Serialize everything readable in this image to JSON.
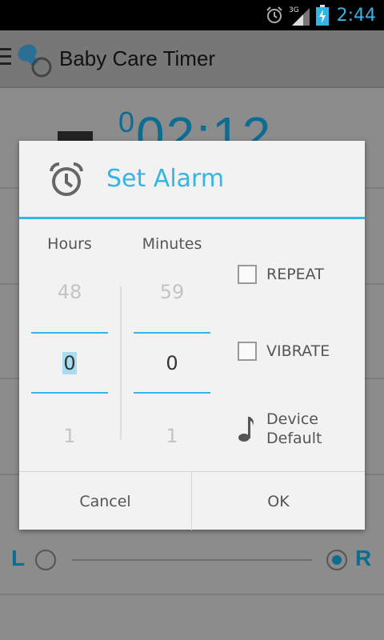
{
  "status_bar": {
    "time": "2:44",
    "network": "3G",
    "icons": [
      "alarm-icon",
      "signal-icon",
      "battery-charging-icon"
    ],
    "accent": "#33b5e5"
  },
  "app": {
    "title": "Baby Care Timer",
    "icons": [
      "menu-icon",
      "pacifier-icon"
    ]
  },
  "background": {
    "timer_superscript": "0",
    "timer_text": "02:12",
    "left_label": "L",
    "right_label": "R",
    "selected_side": "R"
  },
  "dialog": {
    "title": "Set Alarm",
    "title_color": "#33b5e5",
    "hours": {
      "label": "Hours",
      "prev": "48",
      "current": "0",
      "next": "1"
    },
    "minutes": {
      "label": "Minutes",
      "prev": "59",
      "current": "0",
      "next": "1"
    },
    "repeat": {
      "label": "REPEAT",
      "checked": false
    },
    "vibrate": {
      "label": "VIBRATE",
      "checked": false
    },
    "ringtone": {
      "line1": "Device",
      "line2": "Default",
      "icon": "music-note-icon"
    },
    "buttons": {
      "cancel": "Cancel",
      "ok": "OK"
    }
  }
}
